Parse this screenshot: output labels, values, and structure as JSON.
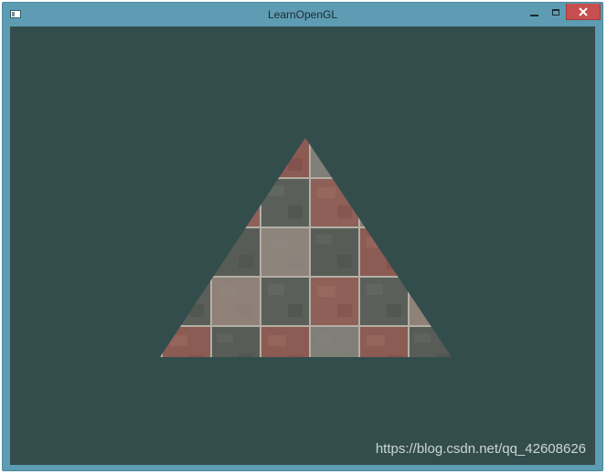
{
  "window": {
    "title": "LearnOpenGL",
    "controls": {
      "minimize": "minimize",
      "maximize": "maximize",
      "close": "close"
    }
  },
  "viewport": {
    "clear_color": "#334d4d",
    "shape": "triangle",
    "texture": "brick-paving-checkerboard",
    "texture_colors": {
      "red_brick": "#8a5a52",
      "dark_stone": "#555a55",
      "light_stone": "#8d8d84",
      "mortar": "#b8b4aa"
    }
  },
  "watermark": {
    "text": "https://blog.csdn.net/qq_42608626"
  }
}
